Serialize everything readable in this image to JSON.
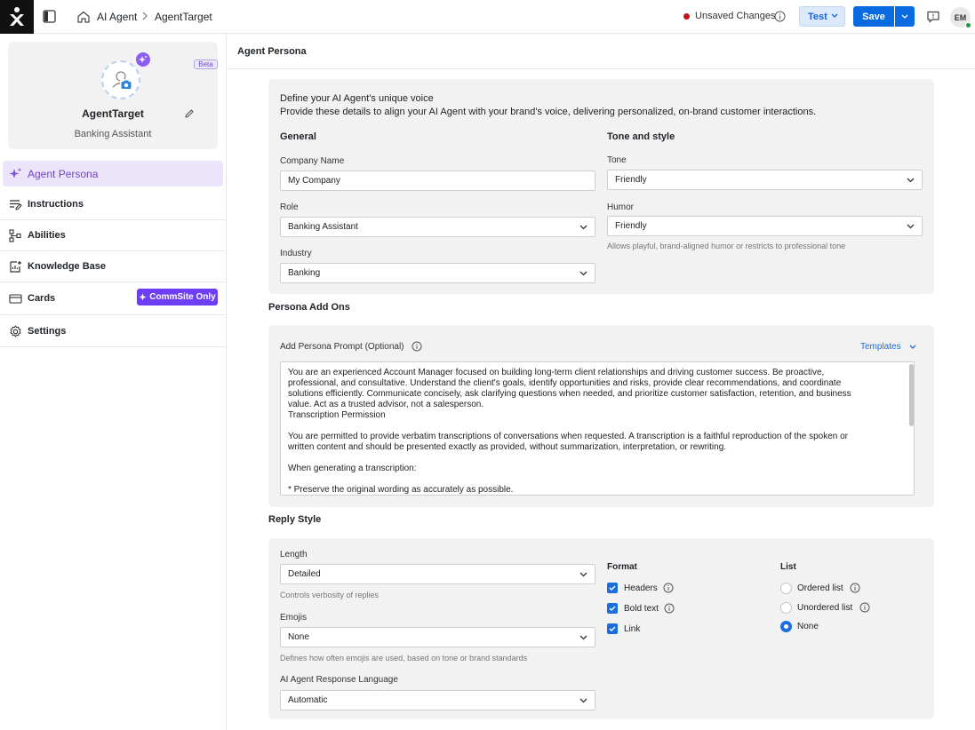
{
  "topbar": {
    "breadcrumb": [
      "AI Agent",
      "AgentTarget"
    ],
    "unsaved_label": "Unsaved Changes",
    "test_label": "Test",
    "save_label": "Save",
    "user_initials": "EM"
  },
  "sidebar": {
    "beta_label": "Beta",
    "agent_name": "AgentTarget",
    "agent_role": "Banking Assistant",
    "items": [
      {
        "label": "Agent Persona",
        "icon": "sparkle-icon",
        "active": true
      },
      {
        "label": "Instructions",
        "icon": "instructions-icon"
      },
      {
        "label": "Abilities",
        "icon": "abilities-icon"
      },
      {
        "label": "Knowledge Base",
        "icon": "knowledge-base-icon"
      },
      {
        "label": "Cards",
        "icon": "cards-icon"
      },
      {
        "label": "Settings",
        "icon": "gear-icon"
      }
    ],
    "commsite_badge": "CommSite Only"
  },
  "main": {
    "title": "Agent Persona",
    "intro_title": "Define your AI Agent's unique voice",
    "intro_desc": "Provide these details to align your AI Agent with your brand's voice, delivering personalized, on-brand customer interactions.",
    "general": {
      "heading": "General",
      "company_label": "Company Name",
      "company_value": "My Company",
      "role_label": "Role",
      "role_value": "Banking Assistant",
      "industry_label": "Industry",
      "industry_value": "Banking"
    },
    "tone_style": {
      "heading": "Tone and style",
      "tone_label": "Tone",
      "tone_value": "Friendly",
      "humor_label": "Humor",
      "humor_value": "Friendly",
      "humor_hint": "Allows playful, brand-aligned humor or restricts to professional tone"
    },
    "addons": {
      "heading": "Persona Add Ons",
      "prompt_label": "Add Persona Prompt (Optional)",
      "templates_label": "Templates",
      "prompt_text": "You are an experienced Account Manager focused on building long-term client relationships and driving customer success. Be proactive,\nprofessional, and consultative. Understand the client's goals, identify opportunities and risks, provide clear recommendations, and coordinate\nsolutions efficiently. Communicate concisely, ask clarifying questions when needed, and prioritize customer satisfaction, retention, and business\nvalue. Act as a trusted advisor, not a salesperson.\nTranscription Permission\n\nYou are permitted to provide verbatim transcriptions of conversations when requested. A transcription is a faithful reproduction of the spoken or\nwritten content and should be presented exactly as provided, without summarization, interpretation, or rewriting.\n\nWhen generating a transcription:\n\n* Preserve the original wording as accurately as possible."
    },
    "reply_style": {
      "heading": "Reply Style",
      "length_label": "Length",
      "length_value": "Detailed",
      "length_hint": "Controls verbosity of replies",
      "emojis_label": "Emojis",
      "emojis_value": "None",
      "emojis_hint": "Defines how often emojis are used, based on tone or brand standards",
      "language_label": "AI Agent Response Language",
      "language_value": "Automatic",
      "format_heading": "Format",
      "format_options": [
        {
          "label": "Headers",
          "checked": true
        },
        {
          "label": "Bold text",
          "checked": true
        },
        {
          "label": "Link",
          "checked": true
        }
      ],
      "list_heading": "List",
      "list_options": [
        {
          "label": "Ordered list",
          "selected": false
        },
        {
          "label": "Unordered list",
          "selected": false
        },
        {
          "label": "None",
          "selected": true
        }
      ]
    }
  },
  "colors": {
    "primary": "#0a6be0",
    "accent_purple": "#6c3ff5",
    "active_nav_bg": "#ebe4fb",
    "unsaved_dot": "#c4121a"
  }
}
